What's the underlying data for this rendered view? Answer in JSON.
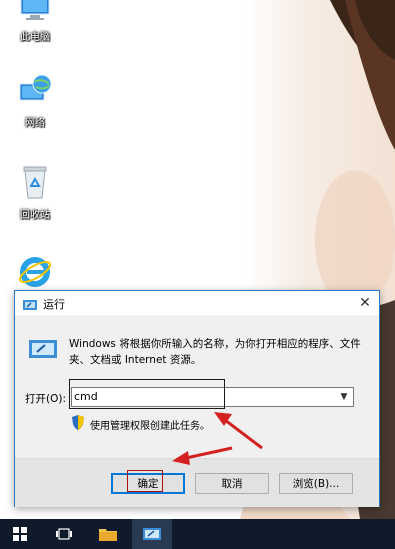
{
  "desktop": {
    "icons": [
      {
        "label": "此电脑",
        "icon": "computer-icon"
      },
      {
        "label": "网络",
        "icon": "network-icon"
      },
      {
        "label": "回收站",
        "icon": "recycle-bin-icon"
      },
      {
        "label": "",
        "icon": "ie-icon"
      }
    ]
  },
  "dialog": {
    "title": "运行",
    "close_glyph": "✕",
    "description": "Windows 将根据你所输入的名称，为你打开相应的程序、文件夹、文档或 Internet 资源。",
    "open_label": "打开(O):",
    "input_value": "cmd",
    "admin_text": "使用管理权限创建此任务。",
    "buttons": {
      "ok": "确定",
      "cancel": "取消",
      "browse": "浏览(B)..."
    }
  },
  "colors": {
    "accent": "#0078d7",
    "annotation_red": "#d42020",
    "taskbar": "#0f1b2a"
  },
  "taskbar": {
    "items": [
      "windows-start-icon",
      "task-view-icon",
      "file-explorer-icon",
      "run-app-icon"
    ]
  }
}
